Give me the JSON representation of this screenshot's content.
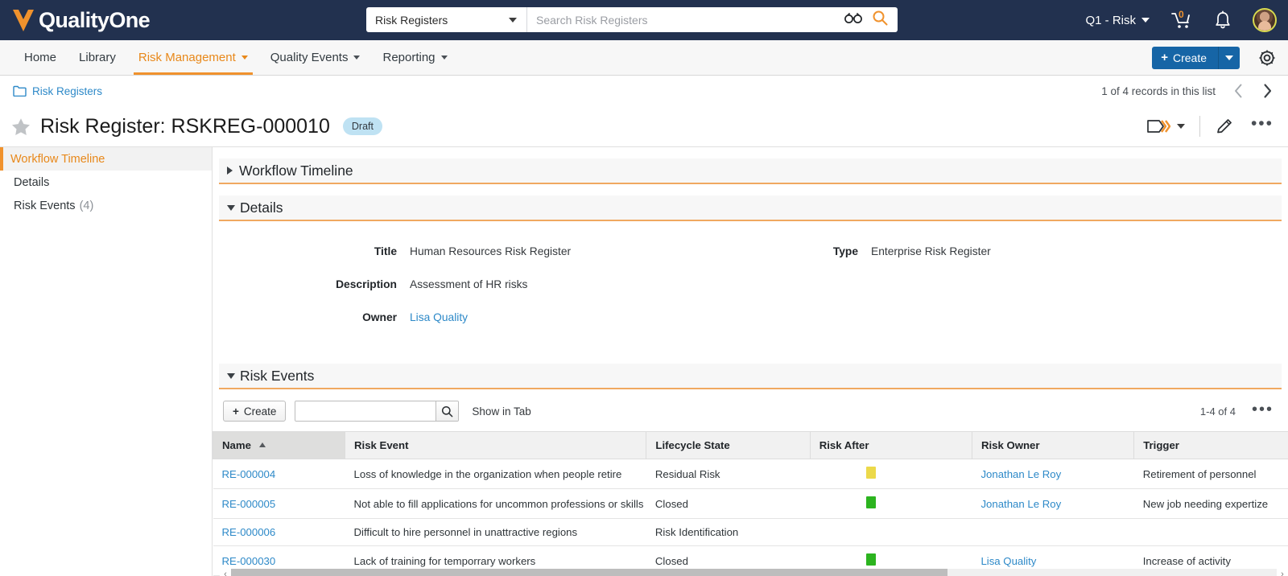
{
  "brand": {
    "name": "QualityOne",
    "accent": "#f0922d",
    "header_bg": "#22314f"
  },
  "topbar": {
    "search_scope": "Risk Registers",
    "search_placeholder": "Search Risk Registers",
    "binoculars_icon": "binoculars-icon",
    "search_icon": "search-icon",
    "domain_label": "Q1 - Risk",
    "cart_count": "0",
    "cart_icon": "cart-icon",
    "bell_icon": "notifications-bell-icon",
    "avatar": "user-avatar"
  },
  "nav": {
    "items": [
      {
        "label": "Home",
        "has_caret": false,
        "active": false
      },
      {
        "label": "Library",
        "has_caret": false,
        "active": false
      },
      {
        "label": "Risk Management",
        "has_caret": true,
        "active": true
      },
      {
        "label": "Quality Events",
        "has_caret": true,
        "active": false
      },
      {
        "label": "Reporting",
        "has_caret": true,
        "active": false
      }
    ],
    "create_label": "Create",
    "create_plus": "+",
    "gear_icon": "settings-gear-icon"
  },
  "breadcrumb": {
    "folder_icon": "folder-icon",
    "label": "Risk Registers",
    "records_text": "1 of 4 records in this list",
    "prev_icon": "chevron-left-icon",
    "next_icon": "chevron-right-icon"
  },
  "record": {
    "star_icon": "favorite-star-icon",
    "title": "Risk Register: RSKREG-000010",
    "state": "Draft",
    "workflow_icon": "workflow-action-icon",
    "edit_icon": "pencil-edit-icon",
    "more_icon": "•••"
  },
  "sidebar": {
    "items": [
      {
        "label": "Workflow Timeline",
        "count": "",
        "active": true
      },
      {
        "label": "Details",
        "count": "",
        "active": false
      },
      {
        "label": "Risk Events",
        "count": "(4)",
        "active": false
      }
    ]
  },
  "sections": {
    "workflow_timeline": {
      "title": "Workflow Timeline",
      "expanded": false
    },
    "details": {
      "title": "Details",
      "expanded": true,
      "left_fields": [
        {
          "label": "Title",
          "value": "Human Resources Risk Register",
          "is_link": false
        },
        {
          "label": "Description",
          "value": "Assessment of HR risks",
          "is_link": false
        },
        {
          "label": "Owner",
          "value": "Lisa Quality",
          "is_link": true
        }
      ],
      "right_fields": [
        {
          "label": "Type",
          "value": "Enterprise Risk Register",
          "is_link": false
        }
      ]
    },
    "risk_events": {
      "title": "Risk Events",
      "expanded": true,
      "create_label": "Create",
      "create_plus": "+",
      "search_value": "",
      "search_icon": "search-icon",
      "show_in_tab": "Show in Tab",
      "count_text": "1-4 of 4",
      "more_icon": "•••",
      "columns": [
        {
          "label": "Name",
          "sorted": true,
          "sort_dir": "asc"
        },
        {
          "label": "Risk Event",
          "sorted": false
        },
        {
          "label": "Lifecycle State",
          "sorted": false
        },
        {
          "label": "Risk After",
          "sorted": false
        },
        {
          "label": "Risk Owner",
          "sorted": false
        },
        {
          "label": "Trigger",
          "sorted": false
        }
      ],
      "rows": [
        {
          "name": "RE-000004",
          "risk_event": "Loss of knowledge in the organization when people retire",
          "lifecycle_state": "Residual Risk",
          "risk_after_color": "#ecd94a",
          "risk_owner": "Jonathan Le Roy",
          "trigger": "Retirement of personnel"
        },
        {
          "name": "RE-000005",
          "risk_event": "Not able to fill applications for uncommon professions or skills",
          "lifecycle_state": "Closed",
          "risk_after_color": "#2cb41f",
          "risk_owner": "Jonathan Le Roy",
          "trigger": "New job needing expertize"
        },
        {
          "name": "RE-000006",
          "risk_event": "Difficult to hire personnel in unattractive regions",
          "lifecycle_state": "Risk Identification",
          "risk_after_color": "",
          "risk_owner": "",
          "trigger": ""
        },
        {
          "name": "RE-000030",
          "risk_event": "Lack of training for temporrary workers",
          "lifecycle_state": "Closed",
          "risk_after_color": "#2cb41f",
          "risk_owner": "Lisa Quality",
          "trigger": "Increase of activity"
        }
      ],
      "scroll_left_icon": "scroll-left-icon",
      "scroll_right_icon": "scroll-right-icon"
    }
  }
}
